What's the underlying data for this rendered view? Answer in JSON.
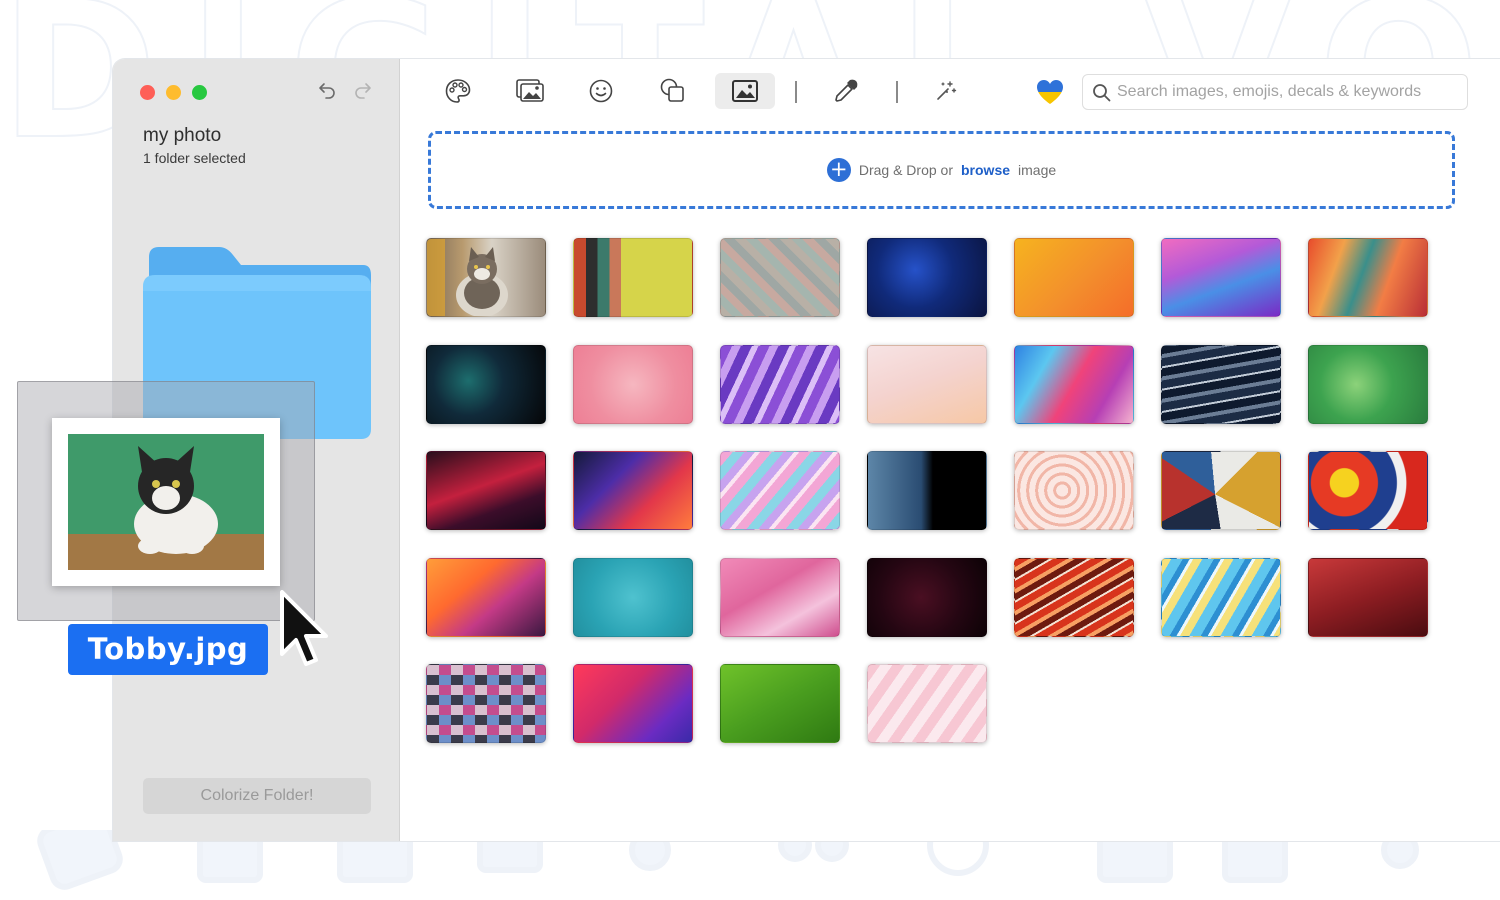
{
  "window": {
    "title": "my photo",
    "subtitle": "1 folder selected"
  },
  "sidebar": {
    "colorize_label": "Colorize Folder!"
  },
  "toolbar": {
    "items": [
      {
        "icon": "palette-icon"
      },
      {
        "icon": "images-icon"
      },
      {
        "icon": "smiley-icon"
      },
      {
        "icon": "shapes-icon"
      },
      {
        "icon": "image-icon",
        "active": true
      },
      {
        "icon": "eyedropper-icon"
      },
      {
        "icon": "magic-wand-icon"
      },
      {
        "icon": "heart-icon"
      }
    ],
    "search_placeholder": "Search images, emojis, decals & keywords"
  },
  "dropzone": {
    "prefix": "Drag & Drop or",
    "link": "browse",
    "suffix": "image"
  },
  "drag": {
    "file_name": "Tobby.jpg"
  },
  "colors": {
    "accent": "#1b6ff2",
    "dropzone_border": "#3879d8"
  },
  "gallery": {
    "rows": 5,
    "columns": 7,
    "tiles": [
      "cat",
      "stripes",
      "scales",
      "blue-ink",
      "orange",
      "purple-wave",
      "abstract-paint",
      "teal-smoke",
      "pink-watercolor",
      "violet-streaks",
      "peach",
      "rainbow-fluid",
      "dark-waves",
      "green-marble",
      "red-swirl",
      "red-blue-gradient",
      "pastel-marble",
      "blue-cells",
      "pink-circles",
      "triangles",
      "splatter",
      "orange-waves",
      "teal-texture",
      "pink-brush",
      "dark-marble",
      "orange-agate",
      "yellow-blue-paint",
      "red-gradient",
      "palette-squares",
      "magenta-gradient",
      "green-leaf",
      "pink-stripes"
    ]
  }
}
